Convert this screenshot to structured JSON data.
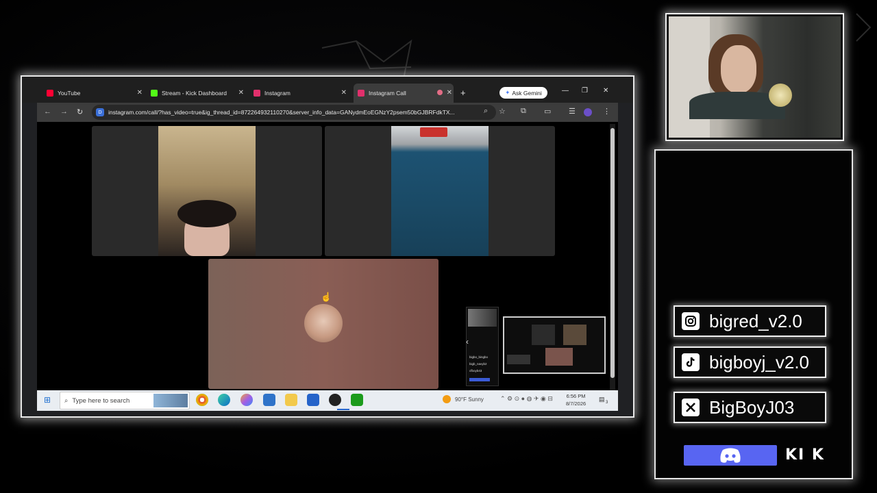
{
  "browser": {
    "tabs": [
      {
        "label": "YouTube",
        "favicon_color": "#ff0033"
      },
      {
        "label": "Stream - Kick Dashboard",
        "favicon_color": "#53fc18"
      },
      {
        "label": "Instagram",
        "favicon_color": "#e1306c"
      },
      {
        "label": "Instagram Call",
        "favicon_color": "#e1306c"
      }
    ],
    "new_tab": "+",
    "gemini_label": "Ask Gemini",
    "url": "instagram.com/call/?has_video=true&ig_thread_id=872264932110270&server_info_data=GANydmEoEGNzY2psem50bGJBRFdkTX...",
    "site_badge": "D"
  },
  "call": {
    "mini_labels": [
      "bigbo_bingbo",
      "bigb_navyb2",
      "cfboyb43"
    ]
  },
  "taskbar": {
    "search_placeholder": "Type here to search",
    "weather": "90°F  Sunny",
    "time": "6:56 PM",
    "date": "8/7/2026",
    "notif_count": "3"
  },
  "socials": {
    "instagram": "bigred_v2.0",
    "tiktok": "bigboyj_v2.0",
    "x": "BigBoyJ03",
    "kick": "KI K"
  },
  "colors": {
    "accent_glow": "#ffffff",
    "discord": "#5865f2",
    "browser_dark": "#1f1f1f"
  }
}
